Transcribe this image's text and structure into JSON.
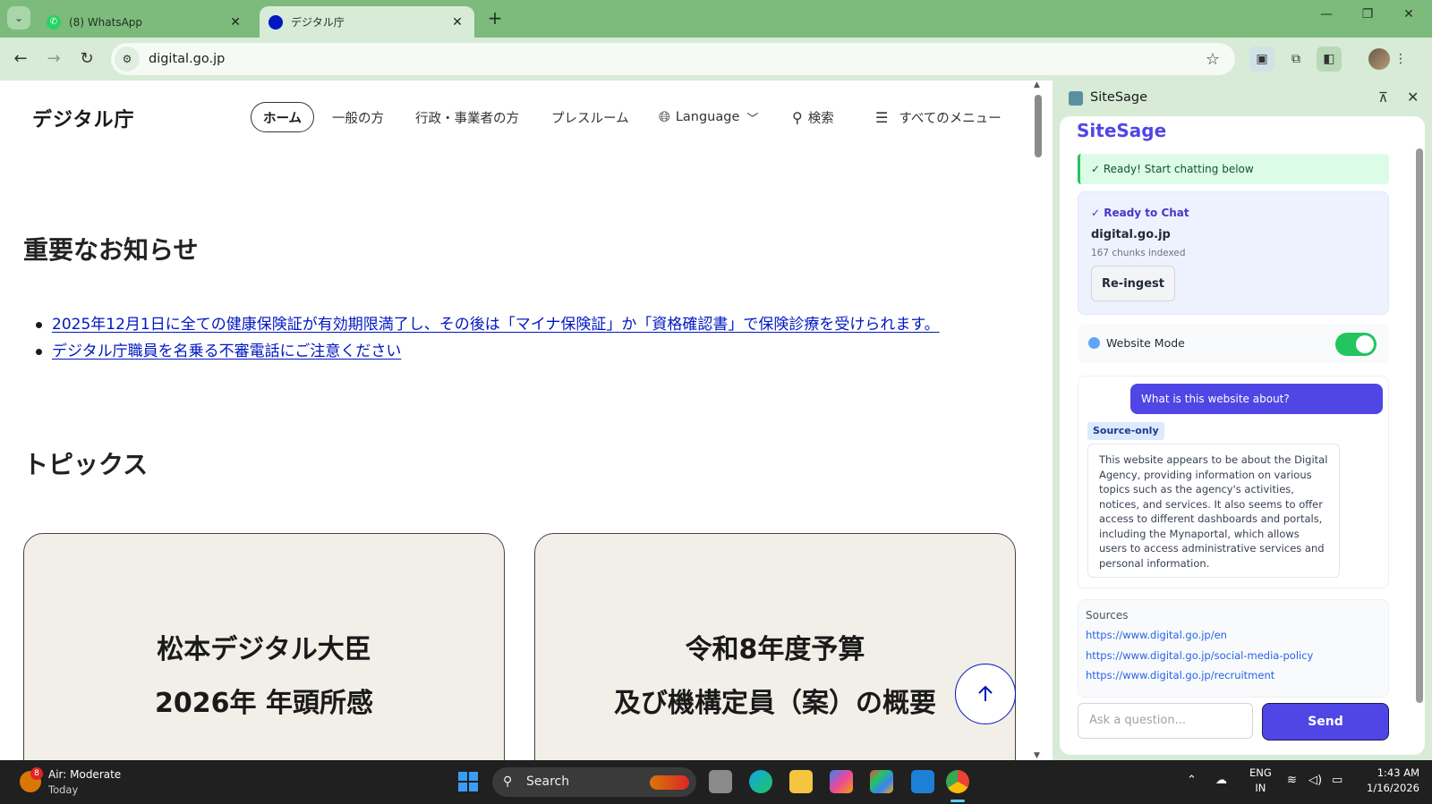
{
  "browser": {
    "tabs": [
      {
        "title": "(8) WhatsApp",
        "icon": "whatsapp-icon"
      },
      {
        "title": "デジタル庁",
        "icon": "digital-agency-icon"
      }
    ],
    "url": "digital.go.jp"
  },
  "page": {
    "logo": "デジタル庁",
    "nav": {
      "home": "ホーム",
      "general": "一般の方",
      "business": "行政・事業者の方",
      "press": "プレスルーム",
      "language": "Language",
      "search": "検索",
      "all_menu": "すべてのメニュー"
    },
    "notices_heading": "重要なお知らせ",
    "notices": [
      "2025年12月1日に全ての健康保険証が有効期限満了し、その後は「マイナ保険証」か「資格確認書」で保険診療を受けられます。",
      "デジタル庁職員を名乗る不審電話にご注意ください"
    ],
    "topics_heading": "トピックス",
    "cards": [
      {
        "line1": "松本デジタル大臣",
        "line2": "2026年 年頭所感"
      },
      {
        "line1": "令和8年度予算",
        "line2": "及び機構定員（案）の概要"
      }
    ]
  },
  "sidepanel": {
    "title": "SiteSage",
    "brand": "SiteSage",
    "banner": "✓ Ready! Start chatting below",
    "status": {
      "label": "✓ Ready to Chat",
      "domain": "digital.go.jp",
      "chunks": "167 chunks indexed",
      "reingest": "Re-ingest"
    },
    "mode_label": "Website Mode",
    "mode_on": true,
    "question": "What is this website about?",
    "source_tag": "Source-only",
    "answer": "This website appears to be about the Digital Agency, providing information on various topics such as the agency's activities, notices, and services. It also seems to offer access to different dashboards and portals, including the Mynaportal, which allows users to access administrative services and personal information.",
    "sources_label": "Sources",
    "sources": [
      "https://www.digital.go.jp/en",
      "https://www.digital.go.jp/social-media-policy",
      "https://www.digital.go.jp/recruitment"
    ],
    "input_placeholder": "Ask a question...",
    "send": "Send"
  },
  "taskbar": {
    "weather_title": "Air: Moderate",
    "weather_sub": "Today",
    "weather_badge": "8",
    "search": "Search",
    "lang_line1": "ENG",
    "lang_line2": "IN",
    "time": "1:43 AM",
    "date": "1/16/2026"
  },
  "colors": {
    "chrome": "#7cbb7c",
    "toolbar": "#d7ebd7",
    "agency_blue": "#0017c1",
    "sitesage_accent": "#4f46e5",
    "toggle_on": "#22c55e"
  }
}
